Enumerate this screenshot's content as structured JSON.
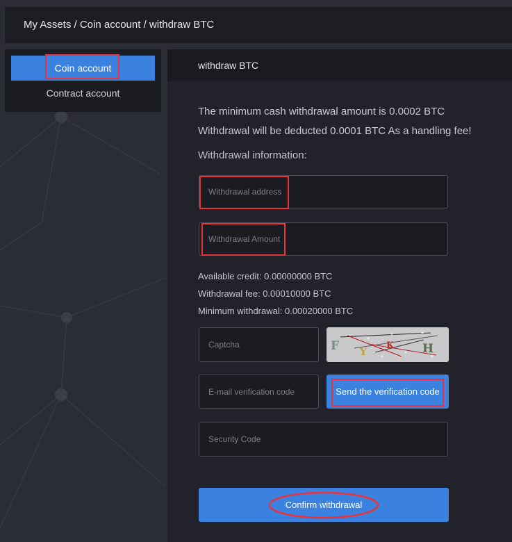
{
  "breadcrumb": "My Assets / Coin account / withdraw BTC",
  "sidebar": {
    "items": [
      {
        "label": "Coin account",
        "active": true
      },
      {
        "label": "Contract account",
        "active": false
      }
    ]
  },
  "panel": {
    "title": "withdraw BTC",
    "notice_min": "The minimum cash withdrawal amount is 0.0002 BTC",
    "notice_fee": "Withdrawal will be deducted 0.0001 BTC As a handling fee!",
    "section_title": "Withdrawal information:",
    "fields": {
      "address_placeholder": "Withdrawal address",
      "amount_placeholder": "Withdrawal Amount",
      "captcha_placeholder": "Captcha",
      "email_code_placeholder": "E-mail verification code",
      "security_code_placeholder": "Security Code"
    },
    "stats": {
      "available": "Available credit: 0.00000000 BTC",
      "fee": "Withdrawal fee: 0.00010000 BTC",
      "minimum": "Minimum withdrawal: 0.00020000 BTC"
    },
    "send_code_label": "Send the verification code",
    "confirm_label": "Confirm withdrawal"
  },
  "captcha_glyphs": [
    "F",
    "Y",
    "K",
    "H"
  ],
  "colors": {
    "accent": "#3b82e0",
    "highlight": "#e8333a",
    "page_bg": "#2b2d36",
    "panel_bg": "#22232a"
  }
}
